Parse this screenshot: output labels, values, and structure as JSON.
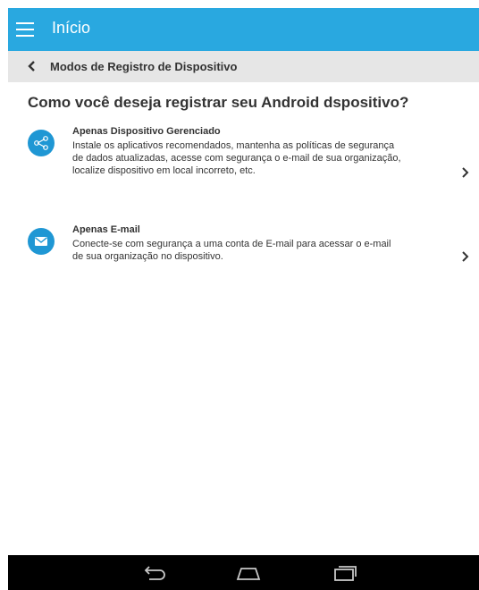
{
  "appbar": {
    "title": "Início"
  },
  "breadcrumb": {
    "label": "Modos de Registro de Dispositivo"
  },
  "question": "Como você deseja registrar seu Android dspositivo?",
  "options": [
    {
      "title": "Apenas Dispositivo Gerenciado",
      "description": "Instale os aplicativos recomendados, mantenha as políticas de segurança de dados atualizadas, acesse com segurança o e-mail de sua organização, localize dispositivo em local incorreto, etc.",
      "icon": "share-icon"
    },
    {
      "title": "Apenas E-mail",
      "description": "Conecte-se com segurança a uma conta de E-mail para acessar o e-mail de sua organização no dispositivo.",
      "icon": "envelope-icon"
    }
  ],
  "colors": {
    "appbar": "#29a8e0",
    "icon_bg": "#1f97d4",
    "breadcrumb_bg": "#e6e6e6",
    "navbar": "#000000"
  }
}
